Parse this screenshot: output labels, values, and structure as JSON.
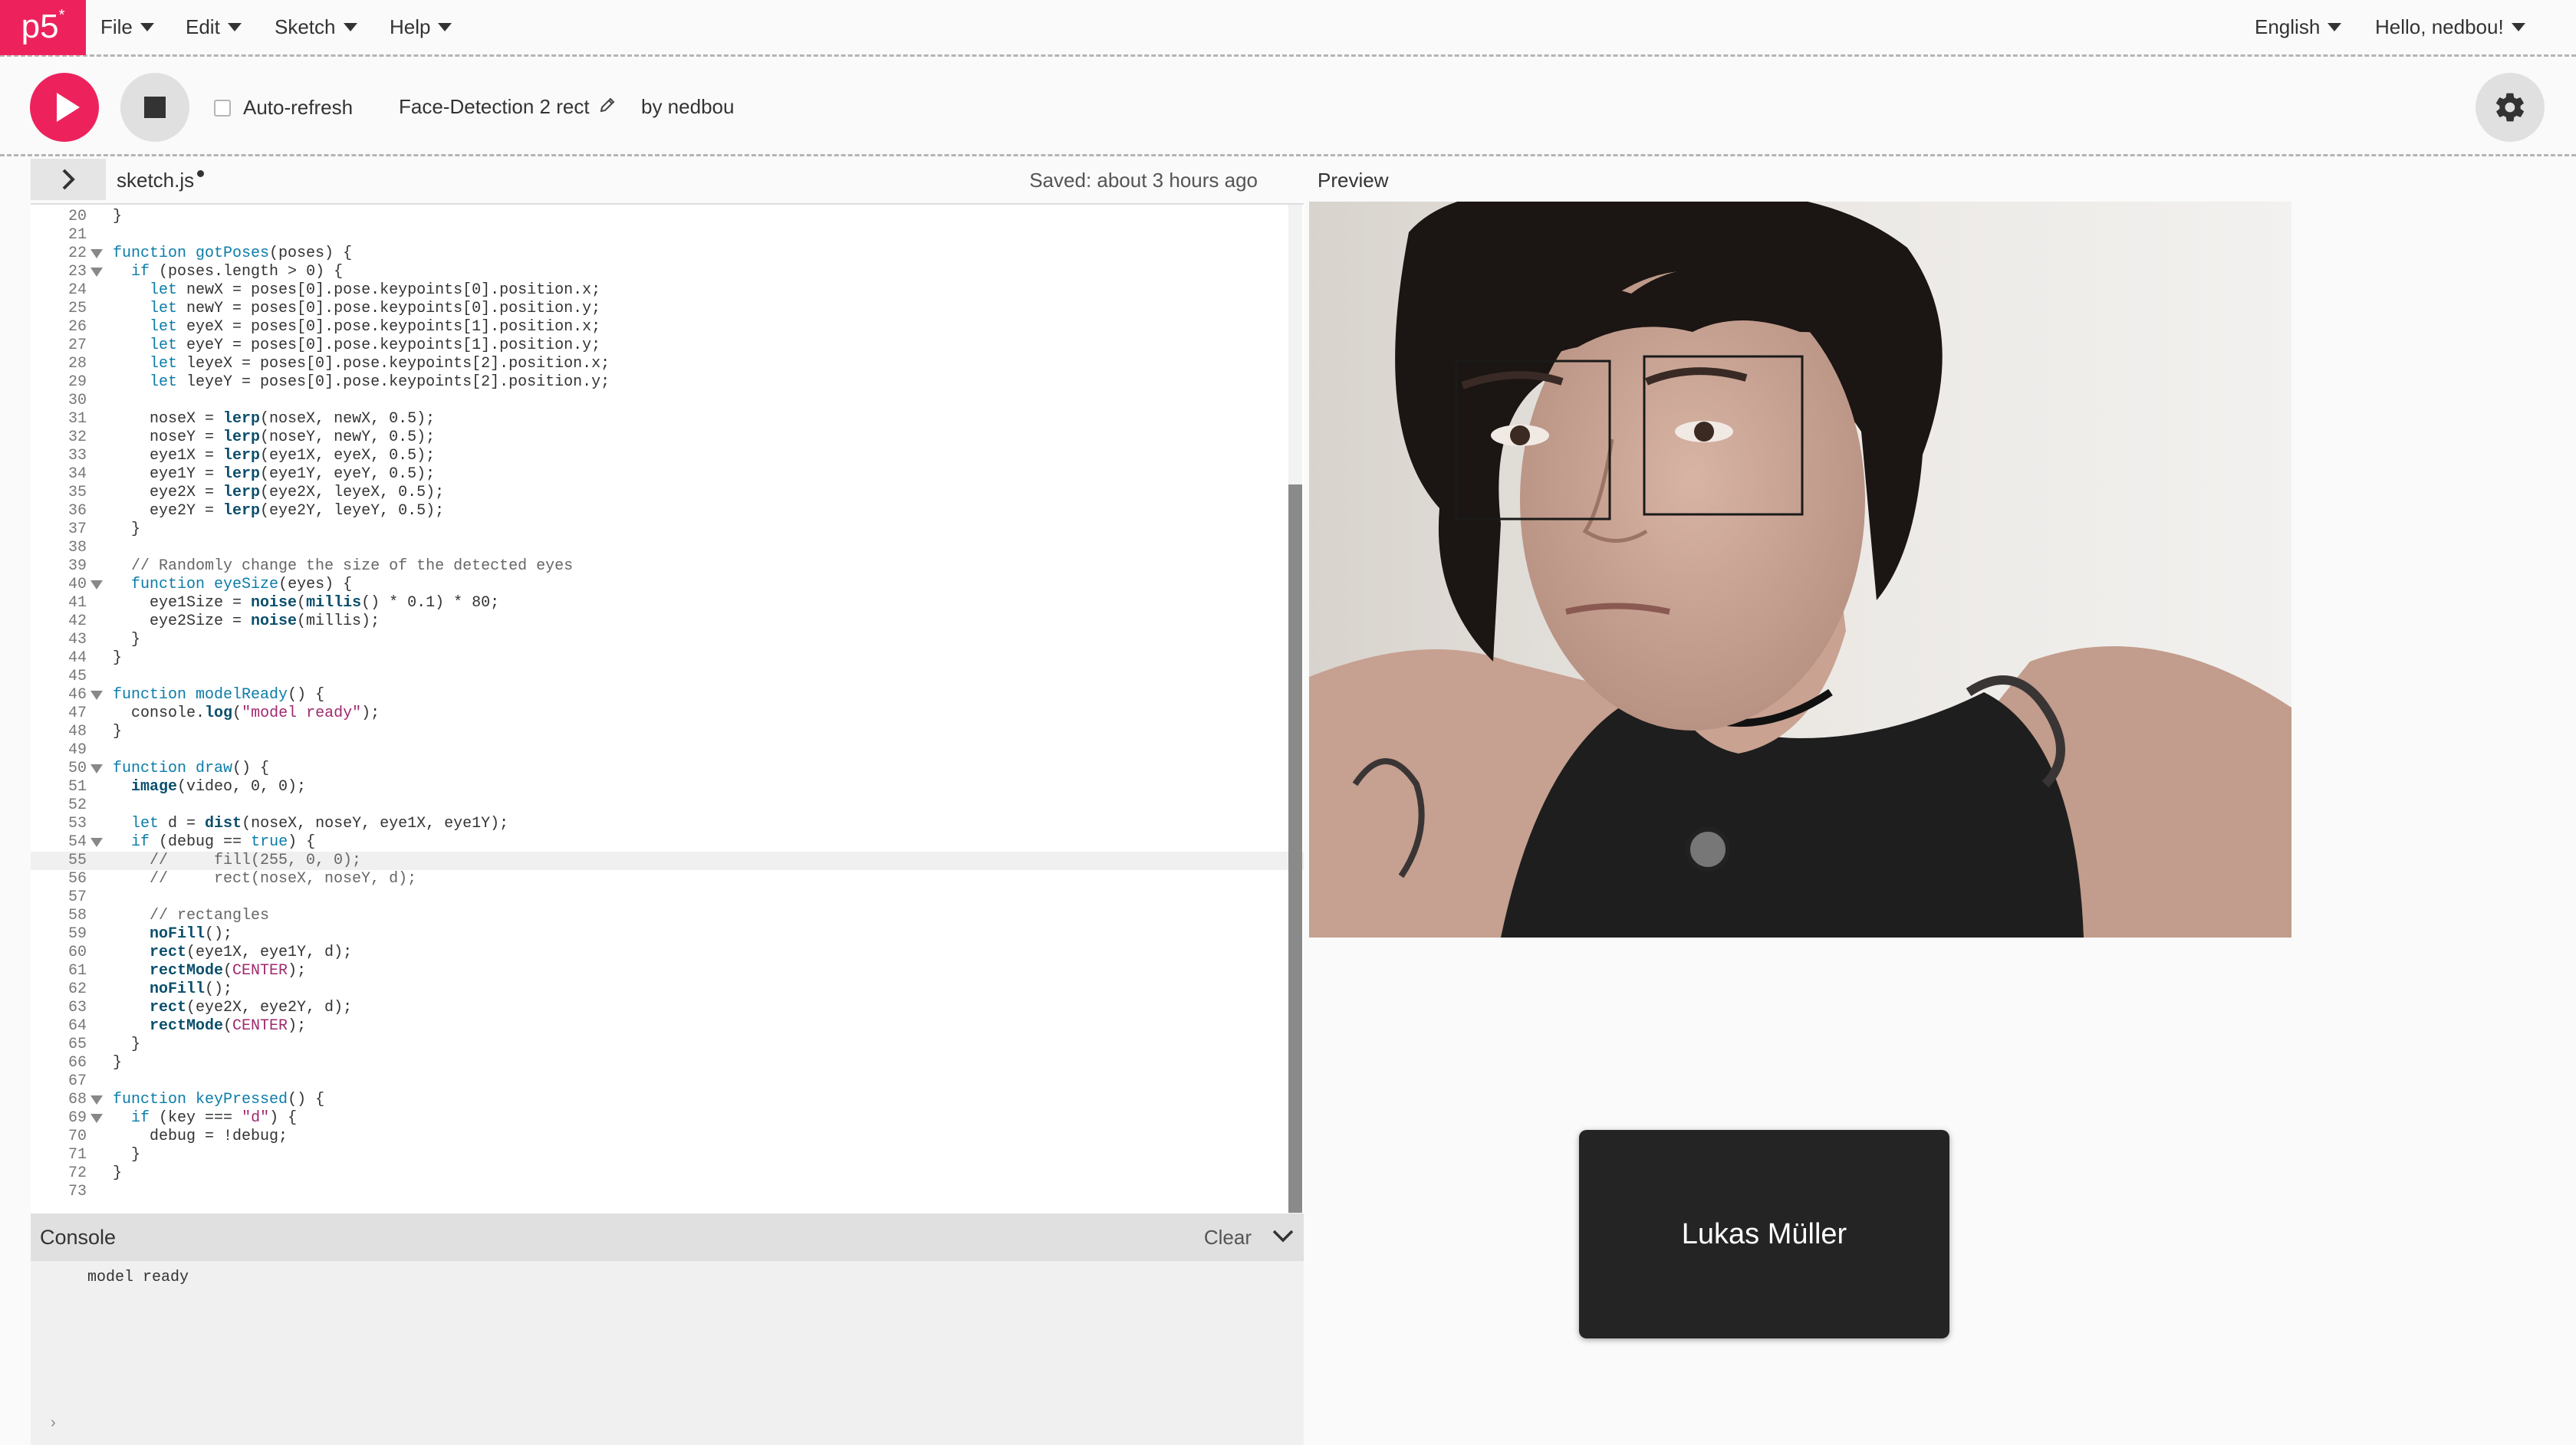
{
  "nav": {
    "logo": "p5",
    "logo_sup": "*",
    "menus": [
      "File",
      "Edit",
      "Sketch",
      "Help"
    ],
    "language": "English",
    "user": "Hello, nedbou!"
  },
  "toolbar": {
    "auto_refresh_label": "Auto-refresh",
    "auto_refresh_checked": false,
    "sketch_name": "Face-Detection 2 rect",
    "owner": "by nedbou"
  },
  "editor": {
    "file_name": "sketch.js",
    "saved_status": "Saved: about 3 hours ago",
    "preview_label": "Preview",
    "active_line": 55,
    "lines": [
      {
        "n": "20",
        "t": "}"
      },
      {
        "n": "21",
        "t": ""
      },
      {
        "n": "22",
        "t": "function gotPoses(poses) {",
        "fold": true
      },
      {
        "n": "23",
        "t": "  if (poses.length > 0) {",
        "fold": true
      },
      {
        "n": "24",
        "t": "    let newX = poses[0].pose.keypoints[0].position.x;"
      },
      {
        "n": "25",
        "t": "    let newY = poses[0].pose.keypoints[0].position.y;"
      },
      {
        "n": "26",
        "t": "    let eyeX = poses[0].pose.keypoints[1].position.x;"
      },
      {
        "n": "27",
        "t": "    let eyeY = poses[0].pose.keypoints[1].position.y;"
      },
      {
        "n": "28",
        "t": "    let leyeX = poses[0].pose.keypoints[2].position.x;"
      },
      {
        "n": "29",
        "t": "    let leyeY = poses[0].pose.keypoints[2].position.y;"
      },
      {
        "n": "30",
        "t": ""
      },
      {
        "n": "31",
        "t": "    noseX = lerp(noseX, newX, 0.5);"
      },
      {
        "n": "32",
        "t": "    noseY = lerp(noseY, newY, 0.5);"
      },
      {
        "n": "33",
        "t": "    eye1X = lerp(eye1X, eyeX, 0.5);"
      },
      {
        "n": "34",
        "t": "    eye1Y = lerp(eye1Y, eyeY, 0.5);"
      },
      {
        "n": "35",
        "t": "    eye2X = lerp(eye2X, leyeX, 0.5);"
      },
      {
        "n": "36",
        "t": "    eye2Y = lerp(eye2Y, leyeY, 0.5);"
      },
      {
        "n": "37",
        "t": "  }"
      },
      {
        "n": "38",
        "t": ""
      },
      {
        "n": "39",
        "t": "  // Randomly change the size of the detected eyes"
      },
      {
        "n": "40",
        "t": "  function eyeSize(eyes) {",
        "fold": true
      },
      {
        "n": "41",
        "t": "    eye1Size = noise(millis() * 0.1) * 80;"
      },
      {
        "n": "42",
        "t": "    eye2Size = noise(millis);"
      },
      {
        "n": "43",
        "t": "  }"
      },
      {
        "n": "44",
        "t": "}"
      },
      {
        "n": "45",
        "t": ""
      },
      {
        "n": "46",
        "t": "function modelReady() {",
        "fold": true
      },
      {
        "n": "47",
        "t": "  console.log(\"model ready\");"
      },
      {
        "n": "48",
        "t": "}"
      },
      {
        "n": "49",
        "t": ""
      },
      {
        "n": "50",
        "t": "function draw() {",
        "fold": true
      },
      {
        "n": "51",
        "t": "  image(video, 0, 0);"
      },
      {
        "n": "52",
        "t": ""
      },
      {
        "n": "53",
        "t": "  let d = dist(noseX, noseY, eye1X, eye1Y);"
      },
      {
        "n": "54",
        "t": "  if (debug == true) {",
        "fold": true
      },
      {
        "n": "55",
        "t": "    //     fill(255, 0, 0);"
      },
      {
        "n": "56",
        "t": "    //     rect(noseX, noseY, d);"
      },
      {
        "n": "57",
        "t": ""
      },
      {
        "n": "58",
        "t": "    // rectangles"
      },
      {
        "n": "59",
        "t": "    noFill();"
      },
      {
        "n": "60",
        "t": "    rect(eye1X, eye1Y, d);"
      },
      {
        "n": "61",
        "t": "    rectMode(CENTER);"
      },
      {
        "n": "62",
        "t": "    noFill();"
      },
      {
        "n": "63",
        "t": "    rect(eye2X, eye2Y, d);"
      },
      {
        "n": "64",
        "t": "    rectMode(CENTER);"
      },
      {
        "n": "65",
        "t": "  }"
      },
      {
        "n": "66",
        "t": "}"
      },
      {
        "n": "67",
        "t": ""
      },
      {
        "n": "68",
        "t": "function keyPressed() {",
        "fold": true
      },
      {
        "n": "69",
        "t": "  if (key === \"d\") {",
        "fold": true
      },
      {
        "n": "70",
        "t": "    debug = !debug;"
      },
      {
        "n": "71",
        "t": "  }"
      },
      {
        "n": "72",
        "t": "}"
      },
      {
        "n": "73",
        "t": ""
      }
    ]
  },
  "console": {
    "title": "Console",
    "clear_label": "Clear",
    "messages": [
      "model ready"
    ],
    "prompt": "›"
  },
  "video_call": {
    "participant_name": "Lukas Müller"
  },
  "colors": {
    "accent": "#ed225d",
    "button_gray": "#e0e0e0"
  }
}
